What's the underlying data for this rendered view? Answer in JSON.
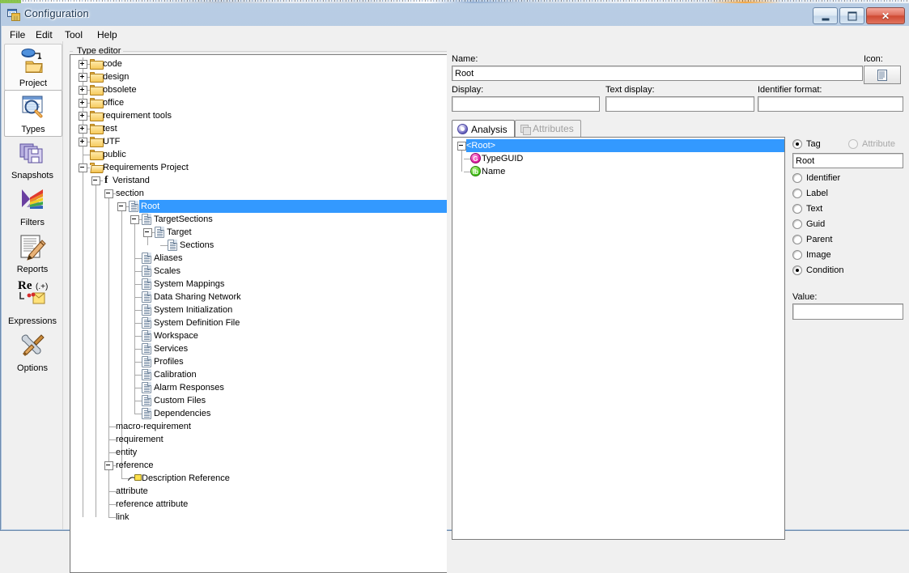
{
  "window": {
    "title": "Configuration",
    "app_icon": "app-window-grid-icon",
    "buttons": {
      "minimize": "–",
      "maximize": "▭",
      "close": "✕"
    }
  },
  "menubar": {
    "items": [
      "File",
      "Edit",
      "Tool",
      "Help"
    ]
  },
  "sidebar": {
    "items": [
      {
        "label": "Project",
        "icon": "project-folder-icon",
        "state": "normal"
      },
      {
        "label": "Types",
        "icon": "types-magnifier-icon",
        "state": "selected"
      },
      {
        "label": "Snapshots",
        "icon": "snapshots-disks-icon",
        "state": "normal"
      },
      {
        "label": "Filters",
        "icon": "filters-prism-icon",
        "state": "normal"
      },
      {
        "label": "Reports",
        "icon": "reports-pencil-icon",
        "state": "normal"
      },
      {
        "label": "Expressions",
        "icon": "expressions-regex-icon",
        "state": "normal"
      },
      {
        "label": "Options",
        "icon": "options-tools-icon",
        "state": "normal"
      }
    ]
  },
  "type_editor": {
    "group_label": "Type editor",
    "tree": [
      {
        "label": "code",
        "depth": 0,
        "icon": "folder",
        "toggle": "plus",
        "selected": false
      },
      {
        "label": "design",
        "depth": 0,
        "icon": "folder",
        "toggle": "plus",
        "selected": false
      },
      {
        "label": "obsolete",
        "depth": 0,
        "icon": "folder",
        "toggle": "plus",
        "selected": false
      },
      {
        "label": "office",
        "depth": 0,
        "icon": "folder",
        "toggle": "plus",
        "selected": false
      },
      {
        "label": "requirement tools",
        "depth": 0,
        "icon": "folder",
        "toggle": "plus",
        "selected": false
      },
      {
        "label": "test",
        "depth": 0,
        "icon": "folder",
        "toggle": "plus",
        "selected": false
      },
      {
        "label": "UTF",
        "depth": 0,
        "icon": "folder",
        "toggle": "plus",
        "selected": false
      },
      {
        "label": "public",
        "depth": 0,
        "icon": "folder",
        "toggle": "none",
        "selected": false
      },
      {
        "label": "Requirements Project",
        "depth": 0,
        "icon": "folder-open",
        "toggle": "minus",
        "selected": false
      },
      {
        "label": "Veristand",
        "depth": 1,
        "icon": "f-glyph",
        "toggle": "minus",
        "selected": false
      },
      {
        "label": "section",
        "depth": 2,
        "icon": "none",
        "toggle": "minus",
        "selected": false
      },
      {
        "label": "Root",
        "depth": 3,
        "icon": "doc",
        "toggle": "minus",
        "selected": true
      },
      {
        "label": "TargetSections",
        "depth": 4,
        "icon": "doc",
        "toggle": "minus",
        "selected": false
      },
      {
        "label": "Target",
        "depth": 5,
        "icon": "doc",
        "toggle": "minus",
        "selected": false
      },
      {
        "label": "Sections",
        "depth": 6,
        "icon": "doc",
        "toggle": "none",
        "selected": false
      },
      {
        "label": "Aliases",
        "depth": 4,
        "icon": "doc",
        "toggle": "none",
        "selected": false
      },
      {
        "label": "Scales",
        "depth": 4,
        "icon": "doc",
        "toggle": "none",
        "selected": false
      },
      {
        "label": "System Mappings",
        "depth": 4,
        "icon": "doc",
        "toggle": "none",
        "selected": false
      },
      {
        "label": "Data Sharing Network",
        "depth": 4,
        "icon": "doc",
        "toggle": "none",
        "selected": false
      },
      {
        "label": "System Initialization",
        "depth": 4,
        "icon": "doc",
        "toggle": "none",
        "selected": false
      },
      {
        "label": "System Definition File",
        "depth": 4,
        "icon": "doc",
        "toggle": "none",
        "selected": false
      },
      {
        "label": "Workspace",
        "depth": 4,
        "icon": "doc",
        "toggle": "none",
        "selected": false
      },
      {
        "label": "Services",
        "depth": 4,
        "icon": "doc",
        "toggle": "none",
        "selected": false
      },
      {
        "label": "Profiles",
        "depth": 4,
        "icon": "doc",
        "toggle": "none",
        "selected": false
      },
      {
        "label": "Calibration",
        "depth": 4,
        "icon": "doc",
        "toggle": "none",
        "selected": false
      },
      {
        "label": "Alarm Responses",
        "depth": 4,
        "icon": "doc",
        "toggle": "none",
        "selected": false
      },
      {
        "label": "Custom Files",
        "depth": 4,
        "icon": "doc",
        "toggle": "none",
        "selected": false
      },
      {
        "label": "Dependencies",
        "depth": 4,
        "icon": "doc",
        "toggle": "none",
        "selected": false
      },
      {
        "label": "macro-requirement",
        "depth": 2,
        "icon": "none",
        "toggle": "none",
        "selected": false
      },
      {
        "label": "requirement",
        "depth": 2,
        "icon": "none",
        "toggle": "none",
        "selected": false
      },
      {
        "label": "entity",
        "depth": 2,
        "icon": "none",
        "toggle": "none",
        "selected": false
      },
      {
        "label": "reference",
        "depth": 2,
        "icon": "none",
        "toggle": "minus",
        "selected": false
      },
      {
        "label": "Description Reference",
        "depth": 3,
        "icon": "ref",
        "toggle": "none",
        "selected": false
      },
      {
        "label": "attribute",
        "depth": 2,
        "icon": "none",
        "toggle": "none",
        "selected": false
      },
      {
        "label": "reference attribute",
        "depth": 2,
        "icon": "none",
        "toggle": "none",
        "selected": false
      },
      {
        "label": "link",
        "depth": 2,
        "icon": "none",
        "toggle": "none",
        "selected": false
      }
    ]
  },
  "properties": {
    "name_label": "Name:",
    "name_value": "Root",
    "icon_label": "Icon:",
    "icon_button": "document-icon",
    "display_label": "Display:",
    "display_value": "",
    "text_display_label": "Text display:",
    "text_display_value": "",
    "identifier_format_label": "Identifier format:",
    "identifier_format_value": ""
  },
  "tabs": [
    {
      "label": "Analysis",
      "icon": "analysis-circle-icon",
      "active": true,
      "disabled": false
    },
    {
      "label": "Attributes",
      "icon": "attributes-panes-icon",
      "active": false,
      "disabled": true
    }
  ],
  "analysis_tree": [
    {
      "label": "<Root>",
      "depth": 0,
      "icon": "none",
      "toggle": "minus",
      "selected": true
    },
    {
      "label": "TypeGUID",
      "depth": 1,
      "icon": "badge-g",
      "badge_text": "G",
      "toggle": "none",
      "selected": false
    },
    {
      "label": "Name",
      "depth": 1,
      "icon": "badge-ib",
      "badge_text": "Ib",
      "toggle": "none",
      "selected": false
    }
  ],
  "options_panel": {
    "top_choices": [
      {
        "label": "Tag",
        "selected": true,
        "disabled": false
      },
      {
        "label": "Attribute",
        "selected": false,
        "disabled": true
      }
    ],
    "tag_value": "Root",
    "radios": [
      {
        "label": "Identifier",
        "selected": false
      },
      {
        "label": "Label",
        "selected": false
      },
      {
        "label": "Text",
        "selected": false
      },
      {
        "label": "Guid",
        "selected": false
      },
      {
        "label": "Parent",
        "selected": false
      },
      {
        "label": "Image",
        "selected": false
      },
      {
        "label": "Condition",
        "selected": true
      }
    ],
    "value_label": "Value:",
    "value_text": ""
  },
  "colors": {
    "selection": "#3399ff",
    "window_bg": "#f0f0f0",
    "panel_bg": "#ffffff",
    "title_text": "#1b3450"
  }
}
